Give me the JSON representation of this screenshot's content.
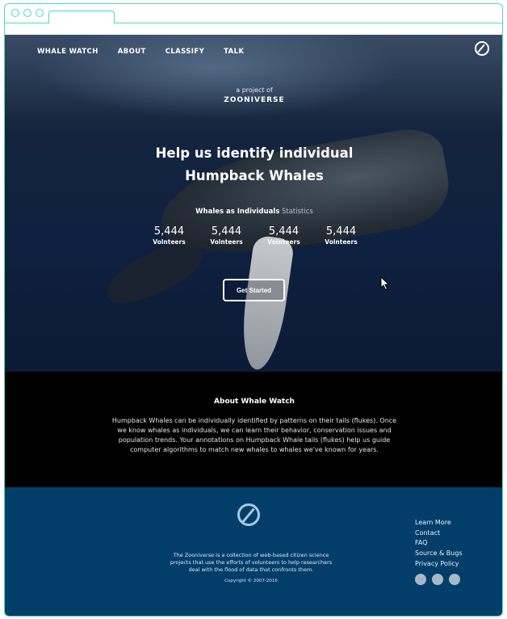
{
  "nav": {
    "items": [
      "WHALE WATCH",
      "ABOUT",
      "CLASSIFY",
      "TALK"
    ],
    "logo_icon": "zooniverse-logo-icon"
  },
  "hero": {
    "project_of": "a project of",
    "zooniverse": "ZOONIVERSE",
    "headline_line1": "Help us identify individual",
    "headline_line2": "Humpback Whales",
    "stats_title_bold": "Whales as Individuals",
    "stats_title_light": "Statistics",
    "stats": [
      {
        "value": "5,444",
        "label": "Volnteers"
      },
      {
        "value": "5,444",
        "label": "Volnteers"
      },
      {
        "value": "5,444",
        "label": "Volnteers"
      },
      {
        "value": "5,444",
        "label": "Volnteers"
      }
    ],
    "cta_label": "Get Started"
  },
  "about": {
    "title": "About Whale Watch",
    "body": "Humpback Whales can be individually identified by patterns on their tails (flukes). Once we know whales as individuals, we can learn their behavior, conservation issues and population trends. Your annotations on Humpback Whale tails (flukes) help us guide computer algorithms to match new whales to whales we've known for years."
  },
  "footer": {
    "logo_icon": "zooniverse-logo-icon",
    "description": "The Zooniverse is a collection of web-based citizen science projects that use the efforts of volunteers to help researchers deal with the flood of data that confronts them.",
    "copyright": "Copyright © 2007-2016",
    "links": [
      "Learn More",
      "Contact",
      "FAQ",
      "Source & Bugs",
      "Privacy Policy"
    ],
    "social_icons": [
      "social-icon-1",
      "social-icon-2",
      "social-icon-3"
    ]
  },
  "colors": {
    "frame": "#49e0b0",
    "about_bg": "#000000",
    "footer_bg": "#033e6b"
  }
}
